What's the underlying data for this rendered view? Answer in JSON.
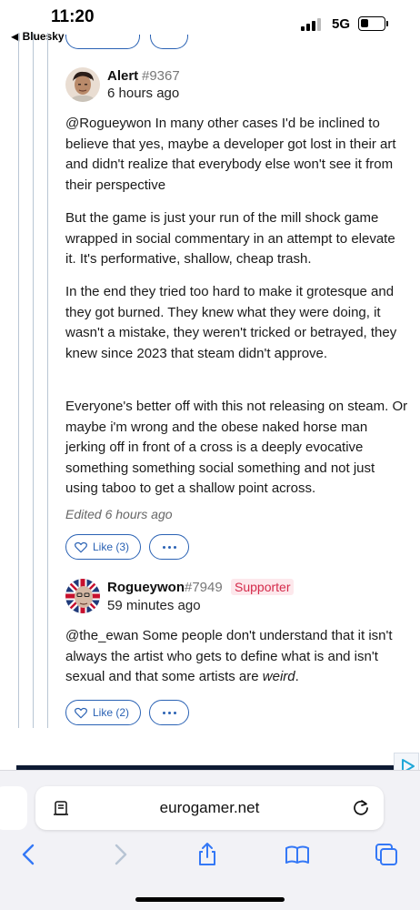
{
  "status_bar": {
    "time": "11:20",
    "back_app": "◀ Bluesky",
    "network": "5G",
    "battery_level": 0.35
  },
  "comments": [
    {
      "username": "Alert",
      "user_id": "#9367",
      "time_ago": "6 hours ago",
      "paragraphs": [
        "@Rogueywon In many other cases I'd be inclined to believe that yes, maybe a developer got lost in their art and didn't realize that everybody else won't see it from their perspective",
        "But the game is just your run of the mill shock game wrapped in social commentary in an attempt to elevate it. It's performative, shallow, cheap trash.",
        "In the end they tried too hard to make it grotesque and they got burned. They knew what they were doing, it wasn't a mistake, they weren't tricked or betrayed, they knew since 2023 that steam didn't approve.",
        "Everyone's better off with this not releasing on steam. Or maybe i'm wrong and the obese naked horse man jerking off in front of a cross is a deeply evocative something something social something and not just using taboo to get a shallow point across."
      ],
      "edited": "Edited 6 hours ago",
      "like_label": "Like (3)"
    },
    {
      "username": "Rogueywon",
      "user_id": "#7949",
      "badge": "Supporter",
      "time_ago": "59 minutes ago",
      "text_before": "@the_ewan Some people don't understand that it isn't always the artist who gets to define what is and isn't sexual and that some artists are ",
      "text_emphasis": "weird",
      "text_after": ".",
      "like_label": "Like (2)"
    }
  ],
  "browser": {
    "url": "eurogamer.net"
  },
  "colors": {
    "accent": "#2a62b4",
    "supporter": "#d42a4a",
    "toolbar_icon": "#3478f6"
  },
  "icons": [
    "heart-icon",
    "more-icon",
    "reader-icon",
    "reload-icon",
    "back-icon",
    "forward-icon",
    "share-icon",
    "bookmarks-icon",
    "tabs-icon",
    "ad-choices-icon"
  ]
}
